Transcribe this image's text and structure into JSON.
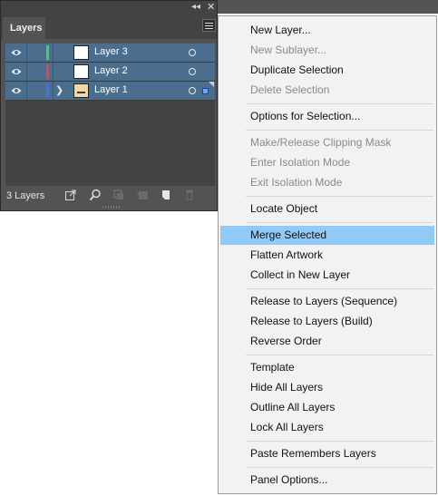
{
  "panel": {
    "tab_label": "Layers",
    "collapse_glyph": "◂◂",
    "close_glyph": "✕",
    "layers": [
      {
        "name": "Layer 3",
        "color": "#3ed65a",
        "has_children": false,
        "has_art": false,
        "selected_art": false
      },
      {
        "name": "Layer 2",
        "color": "#e8463c",
        "has_children": false,
        "has_art": false,
        "selected_art": false
      },
      {
        "name": "Layer 1",
        "color": "#4a6de8",
        "has_children": true,
        "has_art": true,
        "selected_art": true
      }
    ],
    "footer": {
      "count_label": "3 Layers",
      "icons": [
        "export-icon",
        "locate-icon",
        "clipping-mask-icon",
        "new-sublayer-icon",
        "new-layer-icon",
        "trash-icon"
      ]
    }
  },
  "menu": {
    "items": [
      {
        "label": "New Layer...",
        "disabled": false,
        "highlight": false
      },
      {
        "label": "New Sublayer...",
        "disabled": true,
        "highlight": false
      },
      {
        "label": "Duplicate Selection",
        "disabled": false,
        "highlight": false
      },
      {
        "label": "Delete Selection",
        "disabled": true,
        "highlight": false
      },
      {
        "label": "Options for Selection...",
        "disabled": false,
        "highlight": false
      },
      {
        "label": "Make/Release Clipping Mask",
        "disabled": true,
        "highlight": false
      },
      {
        "label": "Enter Isolation Mode",
        "disabled": true,
        "highlight": false
      },
      {
        "label": "Exit Isolation Mode",
        "disabled": true,
        "highlight": false
      },
      {
        "label": "Locate Object",
        "disabled": false,
        "highlight": false
      },
      {
        "label": "Merge Selected",
        "disabled": false,
        "highlight": true
      },
      {
        "label": "Flatten Artwork",
        "disabled": false,
        "highlight": false
      },
      {
        "label": "Collect in New Layer",
        "disabled": false,
        "highlight": false
      },
      {
        "label": "Release to Layers (Sequence)",
        "disabled": false,
        "highlight": false
      },
      {
        "label": "Release to Layers (Build)",
        "disabled": false,
        "highlight": false
      },
      {
        "label": "Reverse Order",
        "disabled": false,
        "highlight": false
      },
      {
        "label": "Template",
        "disabled": false,
        "highlight": false
      },
      {
        "label": "Hide All Layers",
        "disabled": false,
        "highlight": false
      },
      {
        "label": "Outline All Layers",
        "disabled": false,
        "highlight": false
      },
      {
        "label": "Lock All Layers",
        "disabled": false,
        "highlight": false
      },
      {
        "label": "Paste Remembers Layers",
        "disabled": false,
        "highlight": false
      },
      {
        "label": "Panel Options...",
        "disabled": false,
        "highlight": false
      }
    ]
  },
  "colors": {
    "highlight": "#91c9f7",
    "selected_row": "#4b6e8f"
  }
}
